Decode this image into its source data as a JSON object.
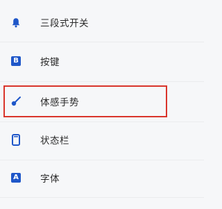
{
  "settings": {
    "items": [
      {
        "label": "三段式开关",
        "icon": "bell-icon"
      },
      {
        "label": "按键",
        "icon": "button-key-icon",
        "icon_text": "B"
      },
      {
        "label": "体感手势",
        "icon": "gesture-icon",
        "highlighted": true
      },
      {
        "label": "状态栏",
        "icon": "phone-status-bar-icon"
      },
      {
        "label": "字体",
        "icon": "font-icon",
        "icon_text": "A"
      }
    ]
  },
  "colors": {
    "accent": "#1f57c9",
    "highlight_border": "#d9342b",
    "background": "#f6f7f9"
  }
}
